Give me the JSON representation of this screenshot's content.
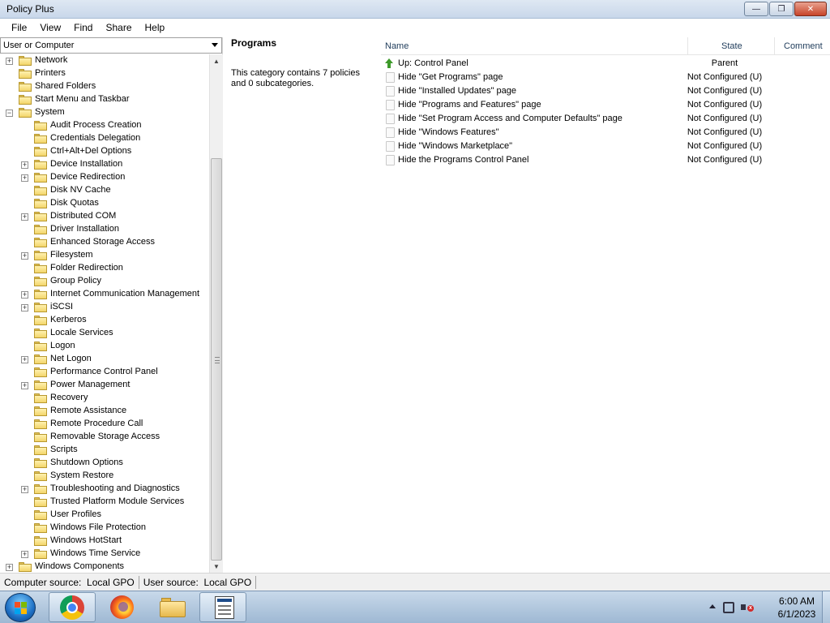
{
  "window": {
    "title": "Policy Plus",
    "minimize_glyph": "—",
    "maximize_glyph": "❐",
    "close_glyph": "✕"
  },
  "menu": [
    "File",
    "View",
    "Find",
    "Share",
    "Help"
  ],
  "scope_selector": {
    "value": "User or Computer"
  },
  "tree": [
    {
      "label": "Network",
      "level": 1,
      "expander": "+"
    },
    {
      "label": "Printers",
      "level": 1,
      "expander": ""
    },
    {
      "label": "Shared Folders",
      "level": 1,
      "expander": ""
    },
    {
      "label": "Start Menu and Taskbar",
      "level": 1,
      "expander": ""
    },
    {
      "label": "System",
      "level": 1,
      "expander": "−"
    },
    {
      "label": "Audit Process Creation",
      "level": 2,
      "expander": ""
    },
    {
      "label": "Credentials Delegation",
      "level": 2,
      "expander": ""
    },
    {
      "label": "Ctrl+Alt+Del Options",
      "level": 2,
      "expander": ""
    },
    {
      "label": "Device Installation",
      "level": 2,
      "expander": "+"
    },
    {
      "label": "Device Redirection",
      "level": 2,
      "expander": "+"
    },
    {
      "label": "Disk NV Cache",
      "level": 2,
      "expander": ""
    },
    {
      "label": "Disk Quotas",
      "level": 2,
      "expander": ""
    },
    {
      "label": "Distributed COM",
      "level": 2,
      "expander": "+"
    },
    {
      "label": "Driver Installation",
      "level": 2,
      "expander": ""
    },
    {
      "label": "Enhanced Storage Access",
      "level": 2,
      "expander": ""
    },
    {
      "label": "Filesystem",
      "level": 2,
      "expander": "+"
    },
    {
      "label": "Folder Redirection",
      "level": 2,
      "expander": ""
    },
    {
      "label": "Group Policy",
      "level": 2,
      "expander": ""
    },
    {
      "label": "Internet Communication Management",
      "level": 2,
      "expander": "+"
    },
    {
      "label": "iSCSI",
      "level": 2,
      "expander": "+"
    },
    {
      "label": "Kerberos",
      "level": 2,
      "expander": ""
    },
    {
      "label": "Locale Services",
      "level": 2,
      "expander": ""
    },
    {
      "label": "Logon",
      "level": 2,
      "expander": ""
    },
    {
      "label": "Net Logon",
      "level": 2,
      "expander": "+"
    },
    {
      "label": "Performance Control Panel",
      "level": 2,
      "expander": ""
    },
    {
      "label": "Power Management",
      "level": 2,
      "expander": "+"
    },
    {
      "label": "Recovery",
      "level": 2,
      "expander": ""
    },
    {
      "label": "Remote Assistance",
      "level": 2,
      "expander": ""
    },
    {
      "label": "Remote Procedure Call",
      "level": 2,
      "expander": ""
    },
    {
      "label": "Removable Storage Access",
      "level": 2,
      "expander": ""
    },
    {
      "label": "Scripts",
      "level": 2,
      "expander": ""
    },
    {
      "label": "Shutdown Options",
      "level": 2,
      "expander": ""
    },
    {
      "label": "System Restore",
      "level": 2,
      "expander": ""
    },
    {
      "label": "Troubleshooting and Diagnostics",
      "level": 2,
      "expander": "+"
    },
    {
      "label": "Trusted Platform Module Services",
      "level": 2,
      "expander": ""
    },
    {
      "label": "User Profiles",
      "level": 2,
      "expander": ""
    },
    {
      "label": "Windows File Protection",
      "level": 2,
      "expander": ""
    },
    {
      "label": "Windows HotStart",
      "level": 2,
      "expander": ""
    },
    {
      "label": "Windows Time Service",
      "level": 2,
      "expander": "+"
    },
    {
      "label": "Windows Components",
      "level": 1,
      "expander": "+"
    }
  ],
  "info": {
    "title": "Programs",
    "description": "This category contains 7 policies and 0 subcategories."
  },
  "list": {
    "columns": [
      "Name",
      "State",
      "Comment"
    ],
    "rows": [
      {
        "name": "Up: Control Panel",
        "state": "Parent",
        "icon": "up-arrow-icon"
      },
      {
        "name": "Hide \"Get Programs\" page",
        "state": "Not Configured (U)",
        "icon": "policy-icon"
      },
      {
        "name": "Hide \"Installed Updates\" page",
        "state": "Not Configured (U)",
        "icon": "policy-icon"
      },
      {
        "name": "Hide \"Programs and Features\" page",
        "state": "Not Configured (U)",
        "icon": "policy-icon"
      },
      {
        "name": "Hide \"Set Program Access and Computer Defaults\" page",
        "state": "Not Configured (U)",
        "icon": "policy-icon"
      },
      {
        "name": "Hide \"Windows Features\"",
        "state": "Not Configured (U)",
        "icon": "policy-icon"
      },
      {
        "name": "Hide \"Windows Marketplace\"",
        "state": "Not Configured (U)",
        "icon": "policy-icon"
      },
      {
        "name": "Hide the Programs Control Panel",
        "state": "Not Configured (U)",
        "icon": "policy-icon"
      }
    ]
  },
  "status": {
    "computer_label": "Computer source:",
    "computer_value": "Local GPO",
    "user_label": "User source:",
    "user_value": "Local GPO"
  },
  "taskbar": {
    "apps": [
      "chrome-icon",
      "firefox-icon",
      "file-explorer-icon",
      "policy-plus-icon"
    ],
    "time": "6:00 AM",
    "date": "6/1/2023"
  }
}
